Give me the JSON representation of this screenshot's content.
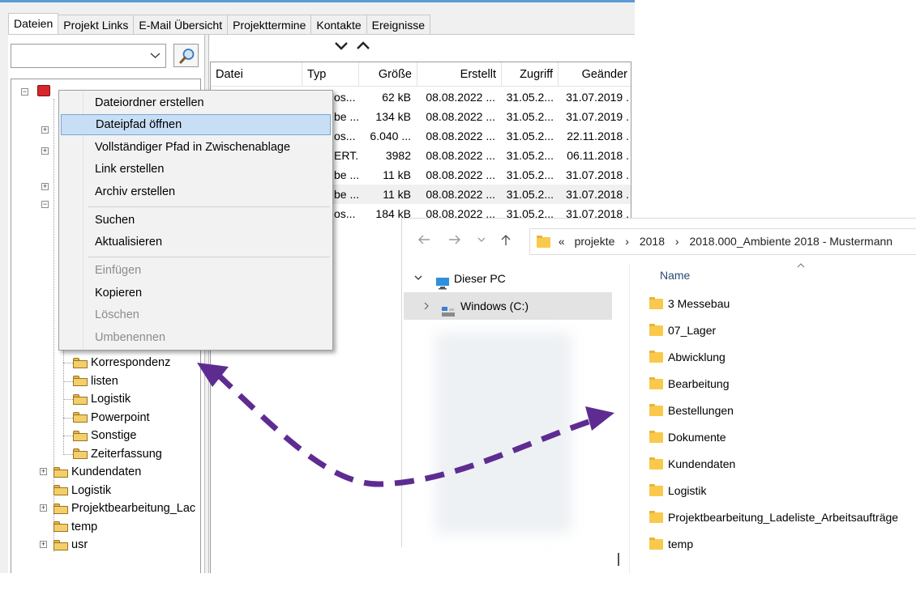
{
  "tabs": [
    {
      "label": "Dateien",
      "active": true
    },
    {
      "label": "Projekt Links"
    },
    {
      "label": "E-Mail Übersicht"
    },
    {
      "label": "Projekttermine"
    },
    {
      "label": "Kontakte"
    },
    {
      "label": "Ereignisse"
    }
  ],
  "search": {
    "value": "",
    "button_icon": "search-icon"
  },
  "sort_arrows": {
    "down": "⌄",
    "up": "⌃"
  },
  "file_list": {
    "columns": [
      "Datei",
      "Typ",
      "Größe",
      "Erstellt",
      "Zugriff",
      "Geänder"
    ],
    "rows": [
      {
        "typ": "os...",
        "size": "62 kB",
        "created": "08.08.2022 ...",
        "access": "31.05.2...",
        "modified": "31.07.2019 ."
      },
      {
        "typ": "be ...",
        "size": "134 kB",
        "created": "08.08.2022 ...",
        "access": "31.05.2...",
        "modified": "31.07.2019 ."
      },
      {
        "typ": "os...",
        "size": "6.040 ...",
        "created": "08.08.2022 ...",
        "access": "31.05.2...",
        "modified": "22.11.2018 ."
      },
      {
        "typ": "ERT...",
        "size": "3982",
        "created": "08.08.2022 ...",
        "access": "31.05.2...",
        "modified": "06.11.2018 ."
      },
      {
        "typ": "be ...",
        "size": "11 kB",
        "created": "08.08.2022 ...",
        "access": "31.05.2...",
        "modified": "31.07.2018 ."
      },
      {
        "typ": "be ...",
        "size": "11 kB",
        "created": "08.08.2022 ...",
        "access": "31.05.2...",
        "modified": "31.07.2018 ."
      },
      {
        "typ": "os...",
        "size": "184 kB",
        "created": "08.08.2022 ...",
        "access": "31.05.2...",
        "modified": "31.07.2018 ."
      }
    ]
  },
  "context_menu": {
    "items": [
      {
        "label": "Dateiordner erstellen"
      },
      {
        "label": "Dateipfad öffnen",
        "highlighted": true
      },
      {
        "label": "Vollständiger Pfad in Zwischenablage"
      },
      {
        "label": "Link erstellen"
      },
      {
        "label": "Archiv erstellen"
      },
      {
        "label": "Suchen"
      },
      {
        "label": "Aktualisieren"
      },
      {
        "label": "Einfügen",
        "disabled": true
      },
      {
        "label": "Kopieren"
      },
      {
        "label": "Löschen",
        "disabled": true
      },
      {
        "label": "Umbenennen",
        "disabled": true
      }
    ]
  },
  "tree": {
    "subfolders": [
      "Korrespondenz",
      "listen",
      "Logistik",
      "Powerpoint",
      "Sonstige",
      "Zeiterfassung"
    ],
    "folders": [
      "Kundendaten",
      "Logistik",
      "Projektbearbeitung_Lac",
      "temp",
      "usr"
    ]
  },
  "explorer": {
    "breadcrumb": [
      "«",
      "projekte",
      "2018",
      "2018.000_Ambiente 2018 - Mustermann"
    ],
    "sidebar": [
      {
        "label": "Dieser PC",
        "icon": "monitor-icon"
      },
      {
        "label": "Windows  (C:)",
        "icon": "drive-icon"
      }
    ],
    "column_name": "Name",
    "items": [
      "3 Messebau",
      "07_Lager",
      "Abwicklung",
      "Bearbeitung",
      "Bestellungen",
      "Dokumente",
      "Kundendaten",
      "Logistik",
      "Projektbearbeitung_Ladeliste_Arbeitsaufträge",
      "temp"
    ]
  },
  "colors": {
    "arrow": "#5e2c91",
    "menu_highlight": "#c8def5",
    "folder": "#f8c94b"
  }
}
